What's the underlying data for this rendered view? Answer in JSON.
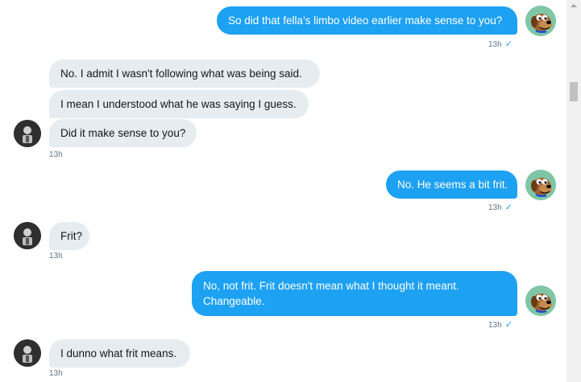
{
  "messages": [
    {
      "text": "So did that fella's limbo video earlier make sense to you?",
      "time": "13h"
    },
    {
      "text": "No. I admit I wasn't following what was being said."
    },
    {
      "text": "I mean I understood what he was saying I guess."
    },
    {
      "text": "Did it make sense to you?",
      "time": "13h"
    },
    {
      "text": "No. He seems a bit frit.",
      "time": "13h"
    },
    {
      "text": "Frit?",
      "time": "13h"
    },
    {
      "text": "No, not frit. Frit doesn't mean what I thought it meant. Changeable.",
      "time": "13h"
    },
    {
      "text": "I dunno what frit means.",
      "time": "13h"
    }
  ],
  "read_receipt": "✓",
  "icons": {
    "self_avatar": "cartoon-dog-avatar",
    "other_avatar": "person-silhouette-avatar"
  },
  "colors": {
    "outgoing_bubble": "#1da1f2",
    "incoming_bubble": "#e6ecf0",
    "timestamp": "#657786"
  }
}
